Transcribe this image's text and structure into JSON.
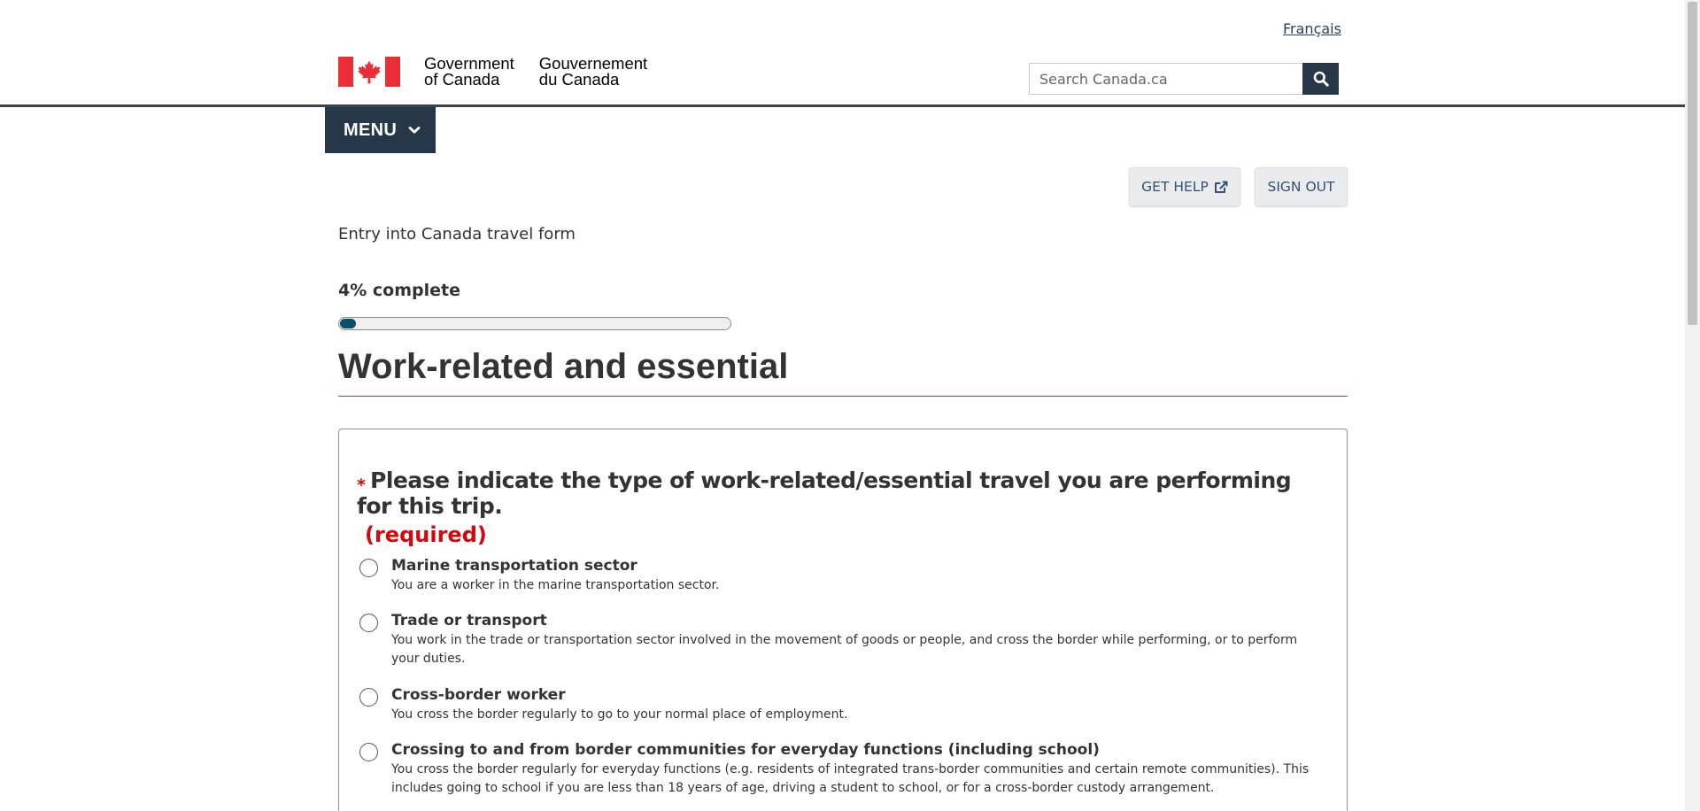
{
  "header": {
    "language_link": "Français",
    "brand": {
      "en_line1": "Government",
      "en_line2": "of Canada",
      "fr_line1": "Gouvernement",
      "fr_line2": "du Canada",
      "flag_colors": {
        "red": "#eb2d37",
        "white": "#ffffff"
      }
    },
    "search": {
      "placeholder": "Search Canada.ca",
      "value": "",
      "button_icon": "search-icon"
    }
  },
  "menu": {
    "label": "MENU",
    "icon": "chevron-down-icon"
  },
  "actions": {
    "get_help": {
      "label": "GET HELP",
      "icon": "external-link-icon"
    },
    "sign_out": {
      "label": "SIGN OUT"
    }
  },
  "form": {
    "name": "Entry into Canada travel form",
    "progress": {
      "label": "4% complete",
      "percent": 4
    },
    "section_title": "Work-related and essential",
    "question": {
      "required_marker": "*",
      "text": "Please indicate the type of work-related/essential travel you are performing for this trip.",
      "required_label": "(required)",
      "options": [
        {
          "label": "Marine transportation sector",
          "description": "You are a worker in the marine transportation sector.",
          "selected": false
        },
        {
          "label": "Trade or transport",
          "description": "You work in the trade or transportation sector involved in the movement of goods or people, and cross the border while performing, or to perform your duties.",
          "selected": false
        },
        {
          "label": "Cross-border worker",
          "description": "You cross the border regularly to go to your normal place of employment.",
          "selected": false
        },
        {
          "label": "Crossing to and from border communities for everyday functions (including school)",
          "description": "You cross the border regularly for everyday functions (e.g. residents of integrated trans-border communities and certain remote communities). This includes going to school if you are less than 18 years of age, driving a student to school, or for a cross-border custody arrangement.",
          "selected": false
        }
      ]
    }
  },
  "colors": {
    "header_rule": "#38414d",
    "menu_bg": "#26374a",
    "progress_fill": "#0b4f6c",
    "title_rule": "#af3c43",
    "required": "#d3080c",
    "link": "#284162"
  }
}
